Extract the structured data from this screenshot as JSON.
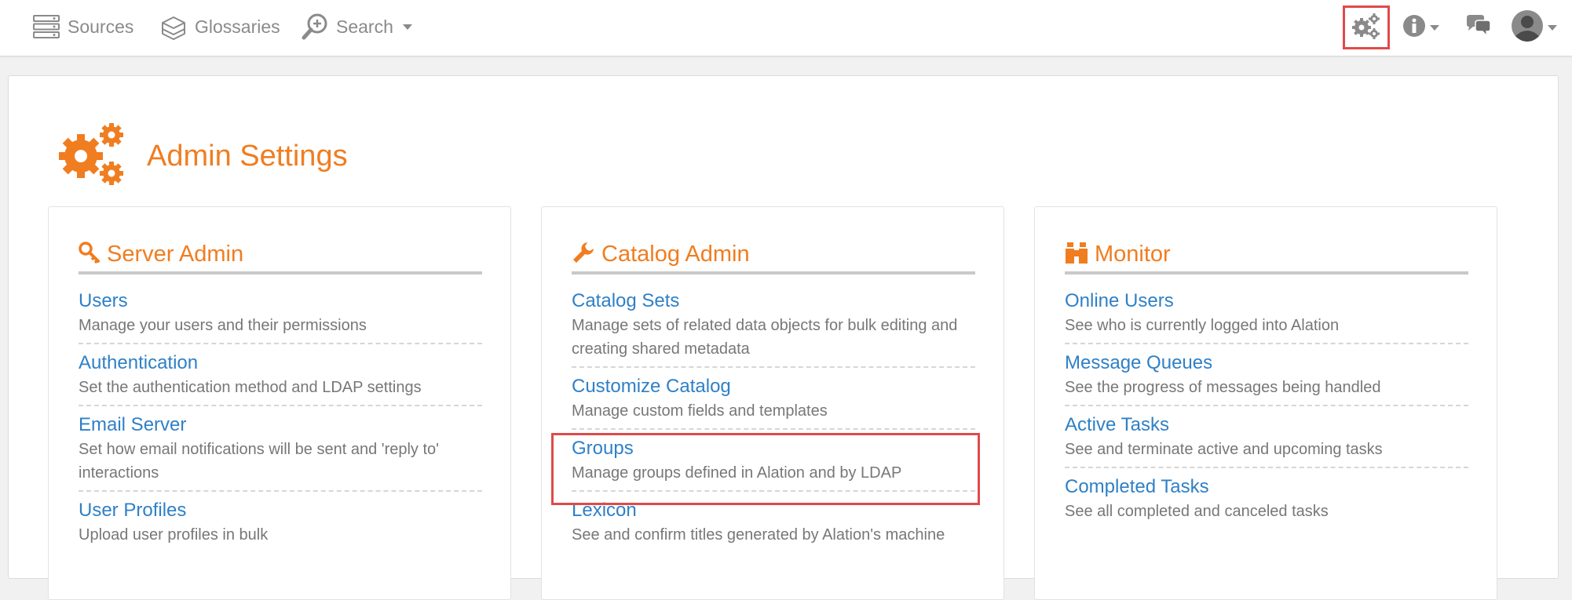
{
  "nav": {
    "sources": "Sources",
    "glossaries": "Glossaries",
    "search": "Search"
  },
  "icons": {
    "sources": "server-stack-icon",
    "glossaries": "books-icon",
    "search": "search-plus-icon",
    "settings": "gears-icon",
    "info": "info-circle-icon",
    "chat": "chat-bubbles-icon",
    "avatar": "user-avatar-icon",
    "page": "gears-icon",
    "server_admin": "key-icon",
    "catalog_admin": "wrench-icon",
    "monitor": "binoculars-icon"
  },
  "colors": {
    "accent_orange": "#f07d20",
    "link_blue": "#2f80c6",
    "highlight_red": "#e04a4a"
  },
  "page": {
    "title": "Admin Settings"
  },
  "server_admin": {
    "title": "Server Admin",
    "items": [
      {
        "title": "Users",
        "desc": "Manage your users and their permissions"
      },
      {
        "title": "Authentication",
        "desc": "Set the authentication method and LDAP settings"
      },
      {
        "title": "Email Server",
        "desc": "Set how email notifications will be sent and 'reply to' interactions"
      },
      {
        "title": "User Profiles",
        "desc": "Upload user profiles in bulk"
      }
    ]
  },
  "catalog_admin": {
    "title": "Catalog Admin",
    "items": [
      {
        "title": "Catalog Sets",
        "desc": "Manage sets of related data objects for bulk editing and creating shared metadata"
      },
      {
        "title": "Customize Catalog",
        "desc": "Manage custom fields and templates"
      },
      {
        "title": "Groups",
        "desc": "Manage groups defined in Alation and by LDAP"
      },
      {
        "title": "Lexicon",
        "desc": "See and confirm titles generated by Alation's machine"
      }
    ]
  },
  "monitor": {
    "title": "Monitor",
    "items": [
      {
        "title": "Online Users",
        "desc": "See who is currently logged into Alation"
      },
      {
        "title": "Message Queues",
        "desc": "See the progress of messages being handled"
      },
      {
        "title": "Active Tasks",
        "desc": "See and terminate active and upcoming tasks"
      },
      {
        "title": "Completed Tasks",
        "desc": "See all completed and canceled tasks"
      }
    ]
  }
}
